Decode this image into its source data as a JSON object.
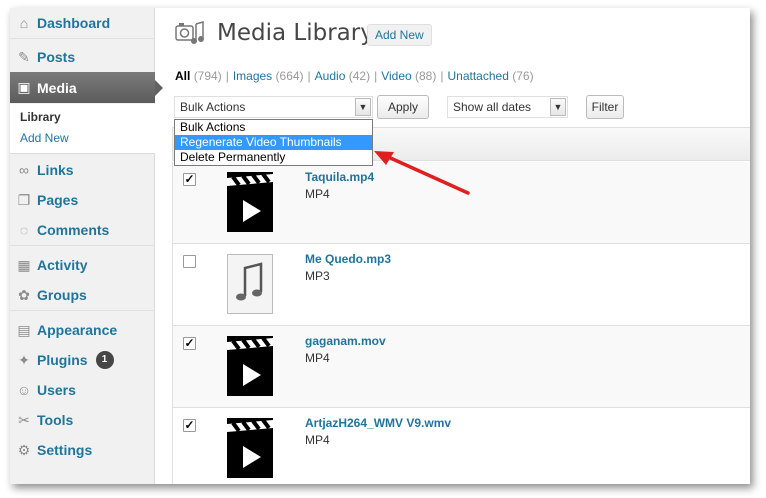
{
  "sidebar": {
    "items": [
      {
        "label": "Dashboard",
        "icon": "dashboard-icon"
      },
      {
        "label": "Posts",
        "icon": "pin-icon"
      },
      {
        "label": "Media",
        "icon": "media-icon"
      },
      {
        "label": "Links",
        "icon": "link-icon"
      },
      {
        "label": "Pages",
        "icon": "pages-icon"
      },
      {
        "label": "Comments",
        "icon": "comment-icon"
      },
      {
        "label": "Activity",
        "icon": "activity-icon"
      },
      {
        "label": "Groups",
        "icon": "groups-icon"
      },
      {
        "label": "Appearance",
        "icon": "appearance-icon"
      },
      {
        "label": "Plugins",
        "icon": "plugin-icon",
        "badge": "1"
      },
      {
        "label": "Users",
        "icon": "users-icon"
      },
      {
        "label": "Tools",
        "icon": "tools-icon"
      },
      {
        "label": "Settings",
        "icon": "settings-icon"
      }
    ],
    "submenu": [
      "Library",
      "Add New"
    ]
  },
  "header": {
    "title": "Media Library",
    "add_new": "Add New"
  },
  "filters": [
    {
      "label": "All",
      "count": "(794)"
    },
    {
      "label": "Images",
      "count": "(664)"
    },
    {
      "label": "Audio",
      "count": "(42)"
    },
    {
      "label": "Video",
      "count": "(88)"
    },
    {
      "label": "Unattached",
      "count": "(76)"
    }
  ],
  "toolbar": {
    "bulk_actions": "Bulk Actions",
    "apply": "Apply",
    "dates": "Show all dates",
    "filter": "Filter"
  },
  "dropdown": {
    "options": [
      "Bulk Actions",
      "Regenerate Video Thumbnails",
      "Delete Permanently"
    ],
    "highlighted_index": 1
  },
  "rows": [
    {
      "name": "Taquila.mp4",
      "type": "MP4",
      "checked": true,
      "thumb": "video-icon"
    },
    {
      "name": "Me Quedo.mp3",
      "type": "MP3",
      "checked": false,
      "thumb": "audio-icon"
    },
    {
      "name": "gaganam.mov",
      "type": "MP4",
      "checked": true,
      "thumb": "video-icon"
    },
    {
      "name": "ArtjazH264_WMV V9.wmv",
      "type": "MP4",
      "checked": true,
      "thumb": "video-icon"
    }
  ],
  "colors": {
    "link": "#21759b",
    "highlight": "#3399ff",
    "arrow": "#e02020"
  }
}
